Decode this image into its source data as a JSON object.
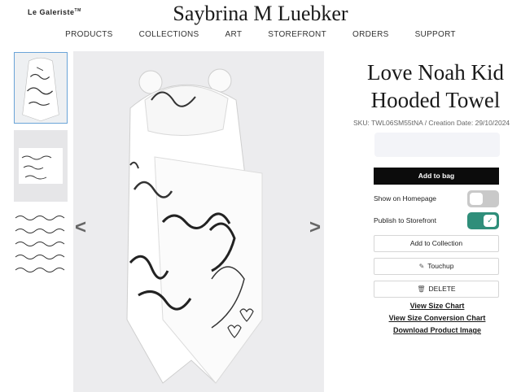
{
  "header": {
    "logo": "Le Galeriste",
    "logo_tm": "TM",
    "shop_title": "Saybrina M Luebker"
  },
  "nav": {
    "items": [
      {
        "label": "PRODUCTS"
      },
      {
        "label": "COLLECTIONS"
      },
      {
        "label": "ART"
      },
      {
        "label": "STOREFRONT"
      },
      {
        "label": "ORDERS"
      },
      {
        "label": "SUPPORT"
      }
    ]
  },
  "gallery": {
    "prev_arrow": "<",
    "next_arrow": ">",
    "thumbnails": 3,
    "active_thumbnail": 1
  },
  "product": {
    "title_line1": "Love Noah Kid",
    "title_line2": "Hooded Towel",
    "sku": "SKU: TWL06SM55tNA / Creation Date: 29/10/2024"
  },
  "actions": {
    "add_to_bag": "Add to bag",
    "show_on_homepage": {
      "label": "Show on Homepage",
      "checked": false
    },
    "publish_to_storefront": {
      "label": "Publish to Storefront",
      "checked": true
    },
    "add_to_collection": "Add to Collection",
    "touchup": "Touchup",
    "delete": "DELETE"
  },
  "links": {
    "size_chart": "View Size Chart",
    "size_conversion": "View Size Conversion Chart",
    "download_image": "Download Product Image"
  },
  "colors": {
    "primary_button": "#0c0c0c",
    "toggle_on": "#2f8e7a",
    "toggle_off": "#c9c9c9",
    "image_background": "#ececee"
  }
}
